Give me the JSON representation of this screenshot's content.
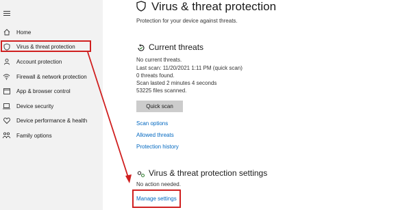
{
  "sidebar": {
    "items": [
      {
        "label": "Home",
        "icon": "home-icon"
      },
      {
        "label": "Virus & threat protection",
        "icon": "shield-icon"
      },
      {
        "label": "Account protection",
        "icon": "person-icon"
      },
      {
        "label": "Firewall & network protection",
        "icon": "wifi-icon"
      },
      {
        "label": "App & browser control",
        "icon": "app-window-icon"
      },
      {
        "label": "Device security",
        "icon": "laptop-icon"
      },
      {
        "label": "Device performance & health",
        "icon": "heart-icon"
      },
      {
        "label": "Family options",
        "icon": "family-icon"
      }
    ]
  },
  "main": {
    "title": "Virus & threat protection",
    "subtitle": "Protection for your device against threats.",
    "current_threats": {
      "title": "Current threats",
      "lines": [
        "No current threats.",
        "Last scan: 11/20/2021 1:11 PM (quick scan)",
        "0 threats found.",
        "Scan lasted 2 minutes 4 seconds",
        "53225 files scanned."
      ],
      "quick_scan_label": "Quick scan",
      "links": [
        "Scan options",
        "Allowed threats",
        "Protection history"
      ]
    },
    "settings": {
      "title": "Virus & threat protection settings",
      "status": "No action needed.",
      "manage_link": "Manage settings"
    }
  },
  "colors": {
    "sidebar_bg": "#f2f2f2",
    "link": "#0067c0",
    "annotation_red": "#d01f1f",
    "button_bg": "#cccccc"
  }
}
